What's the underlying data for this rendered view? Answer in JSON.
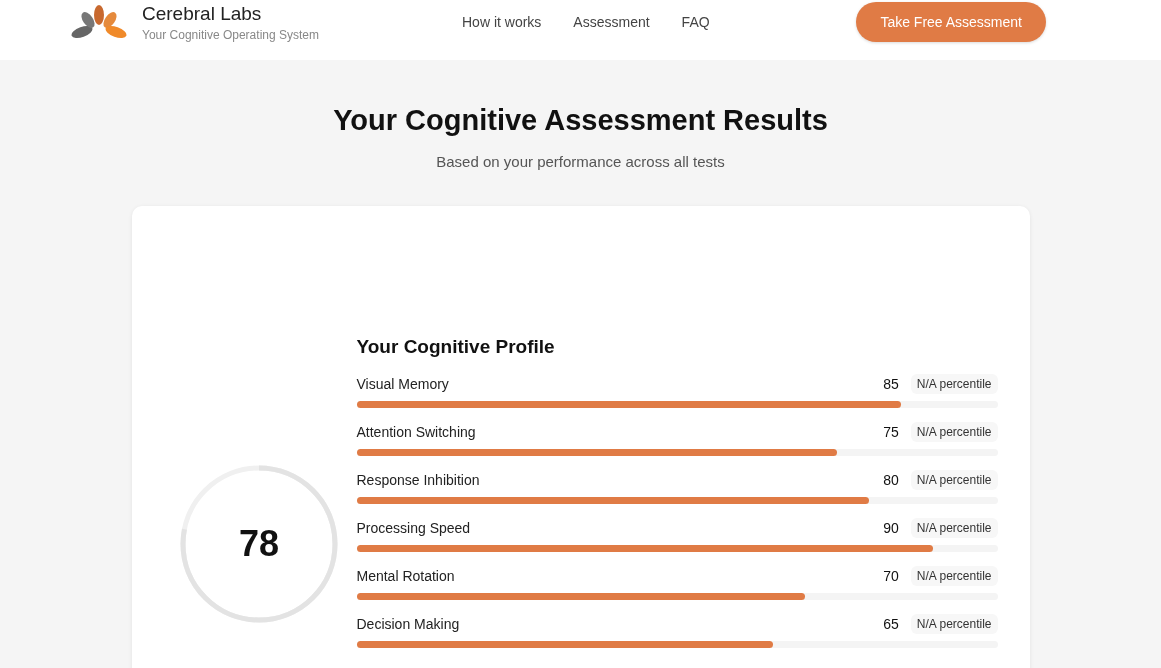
{
  "brand": {
    "name": "Cerebral Labs",
    "tagline": "Your Cognitive Operating System"
  },
  "nav": [
    {
      "label": "How it works"
    },
    {
      "label": "Assessment"
    },
    {
      "label": "FAQ"
    }
  ],
  "cta": "Take Free Assessment",
  "heading": "Your Cognitive Assessment Results",
  "subheading": "Based on your performance across all tests",
  "score": {
    "value": "78"
  },
  "profile": {
    "title": "Your Cognitive Profile",
    "rows": [
      {
        "name": "Visual Memory",
        "score": "85",
        "percentile": "N/A percentile",
        "level": 0.85
      },
      {
        "name": "Attention Switching",
        "score": "75",
        "percentile": "N/A percentile",
        "level": 0.75
      },
      {
        "name": "Response Inhibition",
        "score": "80",
        "percentile": "N/A percentile",
        "level": 0.8
      },
      {
        "name": "Processing Speed",
        "score": "90",
        "percentile": "N/A percentile",
        "level": 0.9
      },
      {
        "name": "Mental Rotation",
        "score": "70",
        "percentile": "N/A percentile",
        "level": 0.7
      },
      {
        "name": "Decision Making",
        "score": "65",
        "percentile": "N/A percentile",
        "level": 0.65
      }
    ]
  }
}
